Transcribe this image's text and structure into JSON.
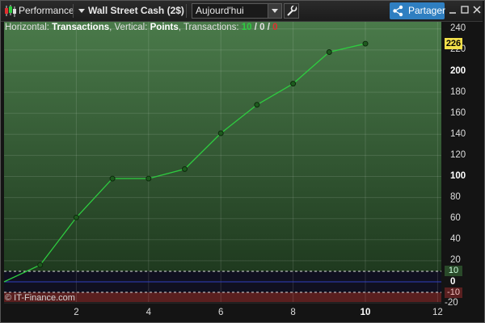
{
  "toolbar": {
    "title": "Performance",
    "instrument": "Wall Street Cash (2$)",
    "period": "Aujourd'hui",
    "share_label": "Partager"
  },
  "info": {
    "prefix": "Horizontal: ",
    "horizontal": "Transactions",
    "mid": ", Vertical: ",
    "vertical": "Points",
    "tx_label": ", Transactions: ",
    "tx_win": "10",
    "sep1": " / ",
    "tx_even": "0",
    "sep2": " / ",
    "tx_loss": "0"
  },
  "watermark": "© IT-Finance.com",
  "colors": {
    "background": "#000000",
    "plot_top": "#4a7a4a",
    "plot_bottom": "#1f3a1f",
    "line": "#2ecc40",
    "accent": "#2f7fc1",
    "last_value": "#f2e04a",
    "loss_band": "#5a1f1f"
  },
  "chart_data": {
    "type": "line",
    "x": [
      0,
      1,
      2,
      3,
      4,
      5,
      6,
      7,
      8,
      9,
      10
    ],
    "values": [
      0,
      16,
      61,
      98,
      98,
      107,
      141,
      168,
      188,
      218,
      226
    ],
    "xlim": [
      0,
      12
    ],
    "ylim": [
      -20,
      245
    ],
    "x_ticks": [
      "2",
      "4",
      "6",
      "8",
      "10",
      "12"
    ],
    "y_ticks": [
      "-20",
      "0",
      "20",
      "40",
      "60",
      "80",
      "100",
      "120",
      "140",
      "160",
      "180",
      "200",
      "220",
      "240"
    ],
    "last_value": "226",
    "band_upper": "10",
    "band_lower": "-10",
    "grid": true
  }
}
